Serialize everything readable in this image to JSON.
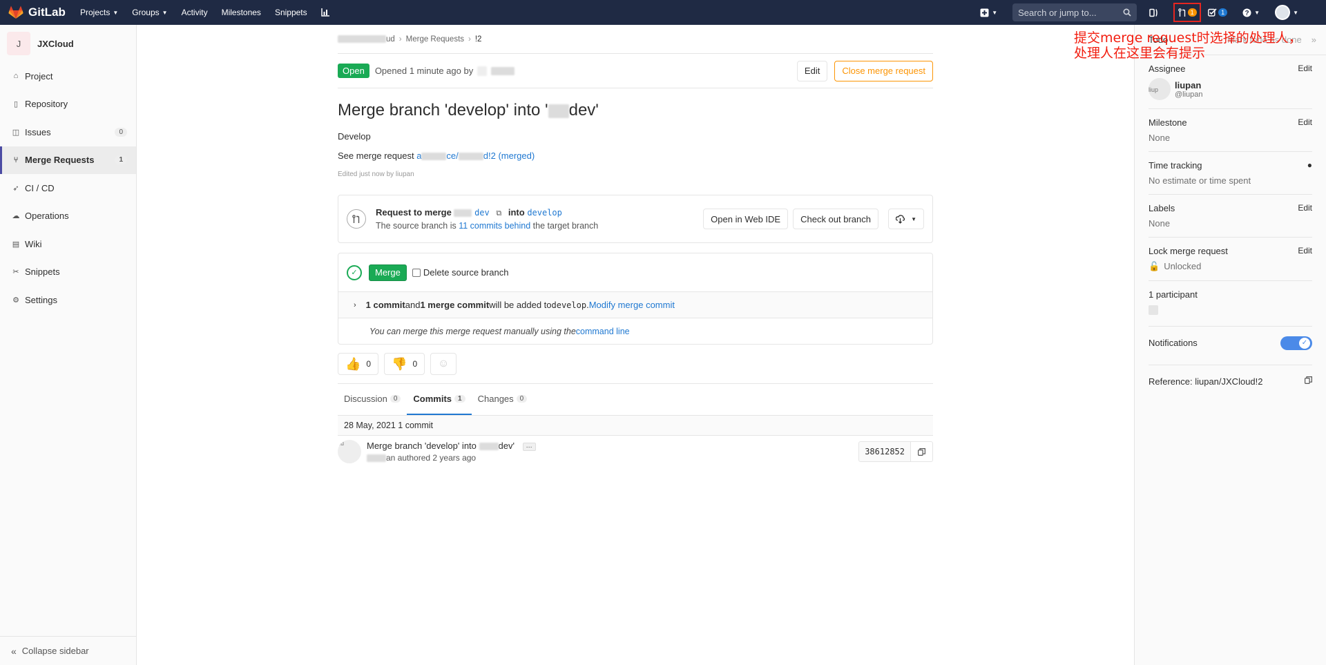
{
  "navbar": {
    "brand": "GitLab",
    "links": [
      {
        "label": "Projects",
        "caret": true
      },
      {
        "label": "Groups",
        "caret": true
      },
      {
        "label": "Activity",
        "caret": false
      },
      {
        "label": "Milestones",
        "caret": false
      },
      {
        "label": "Snippets",
        "caret": false
      }
    ],
    "search_placeholder": "Search or jump to...",
    "mr_count": "1",
    "todo_count": "1",
    "brand_color": "#fc6d26",
    "bg_color": "#1f2a44"
  },
  "sidebar": {
    "project_initial": "J",
    "project_name": "JXCloud",
    "items": [
      {
        "label": "Project",
        "icon": "home-icon",
        "count": ""
      },
      {
        "label": "Repository",
        "icon": "doc-icon",
        "count": ""
      },
      {
        "label": "Issues",
        "icon": "issues-icon",
        "count": "0"
      },
      {
        "label": "Merge Requests",
        "icon": "merge-request-icon",
        "count": "1",
        "active": true
      },
      {
        "label": "CI / CD",
        "icon": "rocket-icon",
        "count": ""
      },
      {
        "label": "Operations",
        "icon": "cloud-gear-icon",
        "count": ""
      },
      {
        "label": "Wiki",
        "icon": "book-icon",
        "count": ""
      },
      {
        "label": "Snippets",
        "icon": "scissors-icon",
        "count": ""
      },
      {
        "label": "Settings",
        "icon": "gear-icon",
        "count": ""
      }
    ],
    "collapse_label": "Collapse sidebar"
  },
  "breadcrumb": {
    "part1": "ud",
    "part2": "Merge Requests",
    "part3": "!2"
  },
  "mr": {
    "status": "Open",
    "opened_text": "Opened",
    "opened_time": "1 minute ago",
    "by": "by",
    "edit_label": "Edit",
    "close_label": "Close merge request",
    "title_prefix": "Merge branch 'develop' into '",
    "title_suffix": "dev'",
    "description": "Develop",
    "see_prefix": "See merge request ",
    "see_link_a": "a",
    "see_link_b": "ce/",
    "see_link_c": "d!2 (merged)",
    "edited_note": "Edited just now by liupan"
  },
  "widget": {
    "request_to_merge": "Request to merge",
    "source_branch": "dev",
    "into": "into",
    "target_branch": "develop",
    "source_is": "The source branch is ",
    "commits_behind": "11 commits behind",
    "the_target": " the target branch",
    "open_web_ide": "Open in Web IDE",
    "check_out_branch": "Check out branch"
  },
  "merge": {
    "merge_label": "Merge",
    "delete_source": "Delete source branch",
    "commit_summary_a": "1 commit",
    "commit_summary_and": " and ",
    "commit_summary_b": "1 merge commit",
    "commit_summary_c": " will be added to ",
    "commit_summary_branch": "develop",
    "commit_summary_d": ". ",
    "modify_link": "Modify merge commit",
    "manual_text": "You can merge this merge request manually using the ",
    "command_line": "command line"
  },
  "awards": {
    "thumbsup": "0",
    "thumbsdown": "0"
  },
  "tabs": [
    {
      "label": "Discussion",
      "count": "0",
      "active": false
    },
    {
      "label": "Commits",
      "count": "1",
      "active": true
    },
    {
      "label": "Changes",
      "count": "0",
      "active": false
    }
  ],
  "commits": {
    "day_header": "28 May, 2021 1 commit",
    "avatar_alt": "liu",
    "title_prefix": "Merge branch 'develop' into ",
    "title_suffix": "dev'",
    "author_suffix": "an authored 2 years ago",
    "sha": "38612852"
  },
  "right_sidebar": {
    "todo_label": "Todo",
    "mark_todo": "Mark todo as done",
    "assignee_title": "Assignee",
    "assignee_edit": "Edit",
    "assignee_avatar_alt": "liup",
    "assignee_name": "liupan",
    "assignee_username": "@liupan",
    "milestone_title": "Milestone",
    "milestone_edit": "Edit",
    "milestone_value": "None",
    "time_title": "Time tracking",
    "time_value": "No estimate or time spent",
    "labels_title": "Labels",
    "labels_edit": "Edit",
    "labels_value": "None",
    "lock_title": "Lock merge request",
    "lock_edit": "Edit",
    "lock_value": "Unlocked",
    "participants_title": "1 participant",
    "notifications_title": "Notifications",
    "notifications_on": true,
    "reference": "Reference: liupan/JXCloud!2"
  },
  "annotation": {
    "line1": "提交merge request时选择的处理人，",
    "line2": "处理人在这里会有提示",
    "color": "#f21d0f"
  }
}
